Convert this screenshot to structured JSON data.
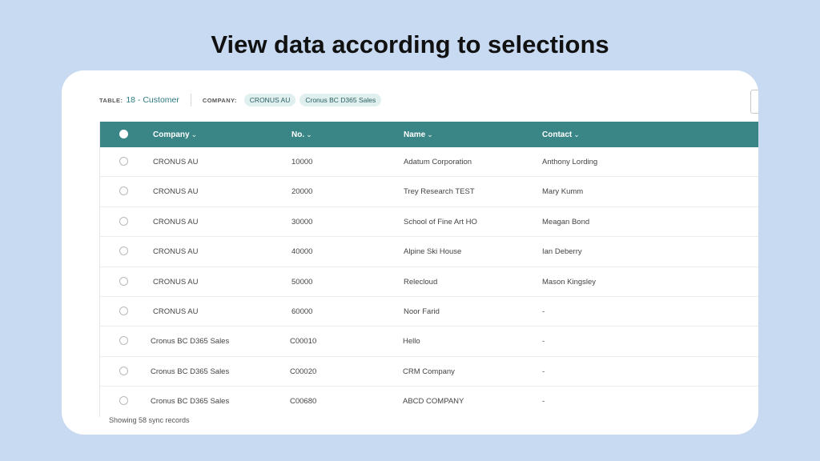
{
  "slide": {
    "title": "View data according to selections"
  },
  "meta": {
    "table_label": "TABLE:",
    "table_value": "18 - Customer",
    "company_label": "COMPANY:",
    "companies": [
      "CRONUS AU",
      "Cronus BC D365 Sales"
    ]
  },
  "grid": {
    "columns": [
      "Company",
      "No.",
      "Name",
      "Contact"
    ],
    "rows": [
      {
        "company": "CRONUS AU",
        "no": "10000",
        "name": "Adatum Corporation",
        "contact": "Anthony Lording"
      },
      {
        "company": "CRONUS AU",
        "no": "20000",
        "name": "Trey Research TEST",
        "contact": "Mary Kumm"
      },
      {
        "company": "CRONUS AU",
        "no": "30000",
        "name": "School of Fine Art HO",
        "contact": "Meagan Bond"
      },
      {
        "company": "CRONUS AU",
        "no": "40000",
        "name": "Alpine Ski House",
        "contact": "Ian Deberry"
      },
      {
        "company": "CRONUS AU",
        "no": "50000",
        "name": "Relecloud",
        "contact": "Mason Kingsley"
      },
      {
        "company": "CRONUS AU",
        "no": "60000",
        "name": "Noor Farid",
        "contact": "-"
      },
      {
        "company": "Cronus BC D365 Sales",
        "no": "C00010",
        "name": "Hello",
        "contact": "-"
      },
      {
        "company": "Cronus BC D365 Sales",
        "no": "C00020",
        "name": "CRM Company",
        "contact": "-"
      },
      {
        "company": "Cronus BC D365 Sales",
        "no": "C00680",
        "name": "ABCD COMPANY",
        "contact": "-"
      }
    ]
  },
  "footer": {
    "status": "Showing 58 sync records"
  },
  "colors": {
    "header_bg": "#3a8585",
    "accent_text": "#2f7a80",
    "chip_bg": "#dff0ee",
    "page_bg": "#c8daf2"
  },
  "icons": {
    "sort": "chevron-down-icon",
    "select": "radio-icon"
  }
}
